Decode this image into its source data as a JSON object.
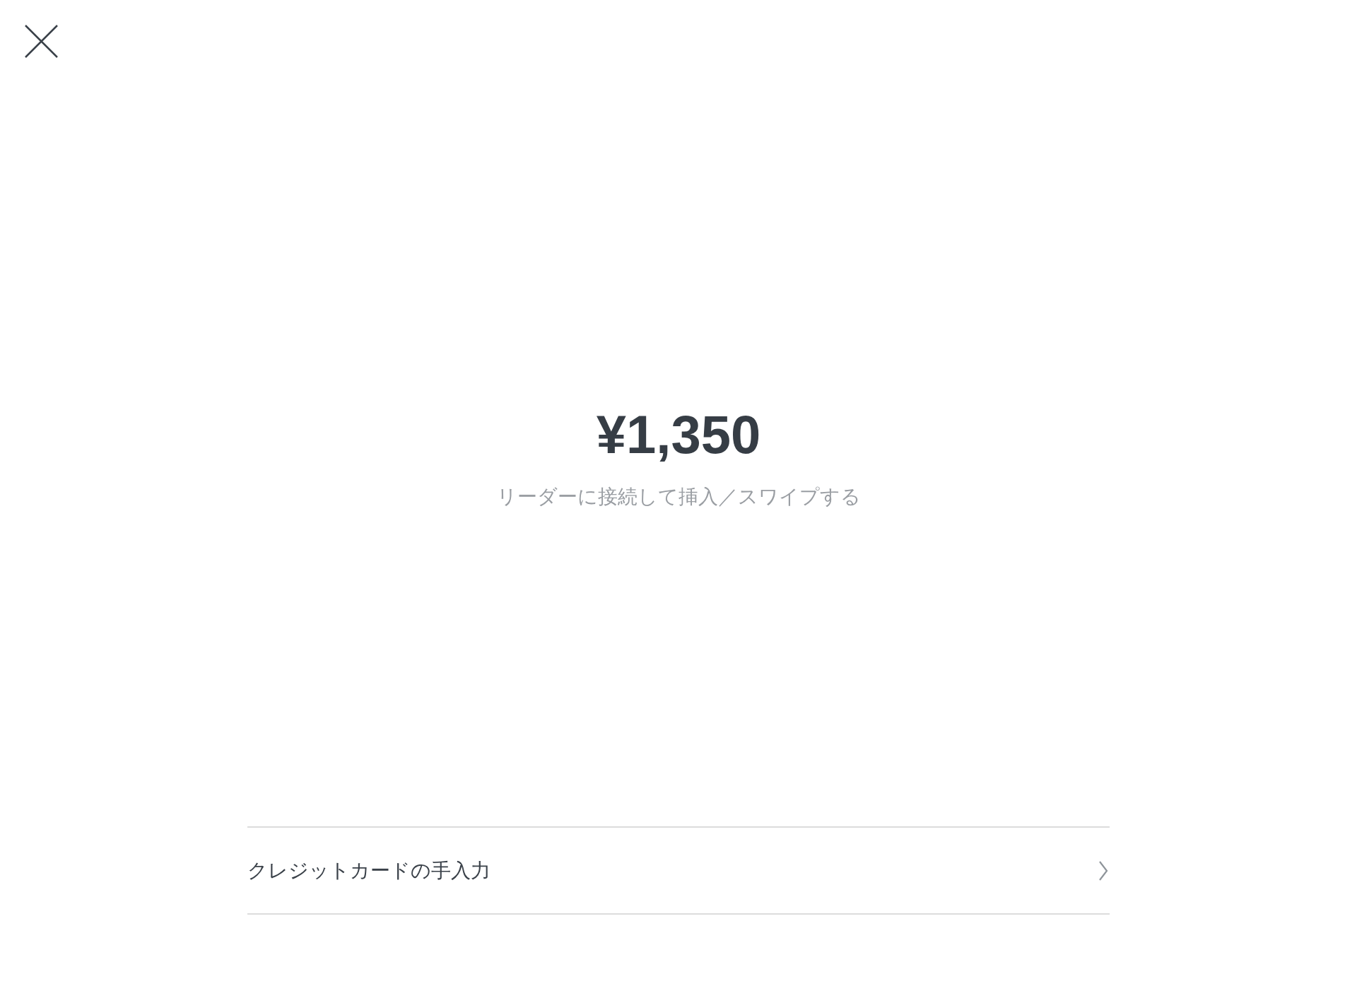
{
  "amount": "¥1,350",
  "instruction": "リーダーに接続して挿入／スワイプする",
  "menu_items": [
    {
      "label": "クレジットカードの手入力"
    }
  ]
}
